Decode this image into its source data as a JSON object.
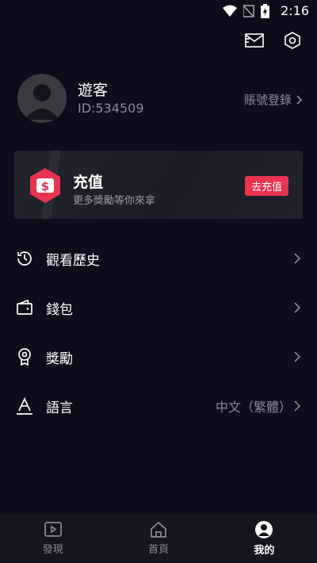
{
  "status": {
    "time": "2:16"
  },
  "profile": {
    "name": "遊客",
    "uid": "ID:534509",
    "login_link": "賬號登錄"
  },
  "recharge": {
    "title": "充值",
    "subtitle": "更多獎勵等你來拿",
    "button": "去充值",
    "accent": "#e8344f"
  },
  "menu": {
    "items": [
      {
        "label": "觀看歷史",
        "icon": "history-icon",
        "value": ""
      },
      {
        "label": "錢包",
        "icon": "wallet-icon",
        "value": ""
      },
      {
        "label": "獎勵",
        "icon": "reward-icon",
        "value": ""
      },
      {
        "label": "語言",
        "icon": "language-icon",
        "value": "中文（繁體）"
      }
    ]
  },
  "tabs": [
    {
      "label": "發現",
      "icon": "play-square-icon",
      "active": false
    },
    {
      "label": "首頁",
      "icon": "home-icon",
      "active": false
    },
    {
      "label": "我的",
      "icon": "user-circle-icon",
      "active": true
    }
  ]
}
